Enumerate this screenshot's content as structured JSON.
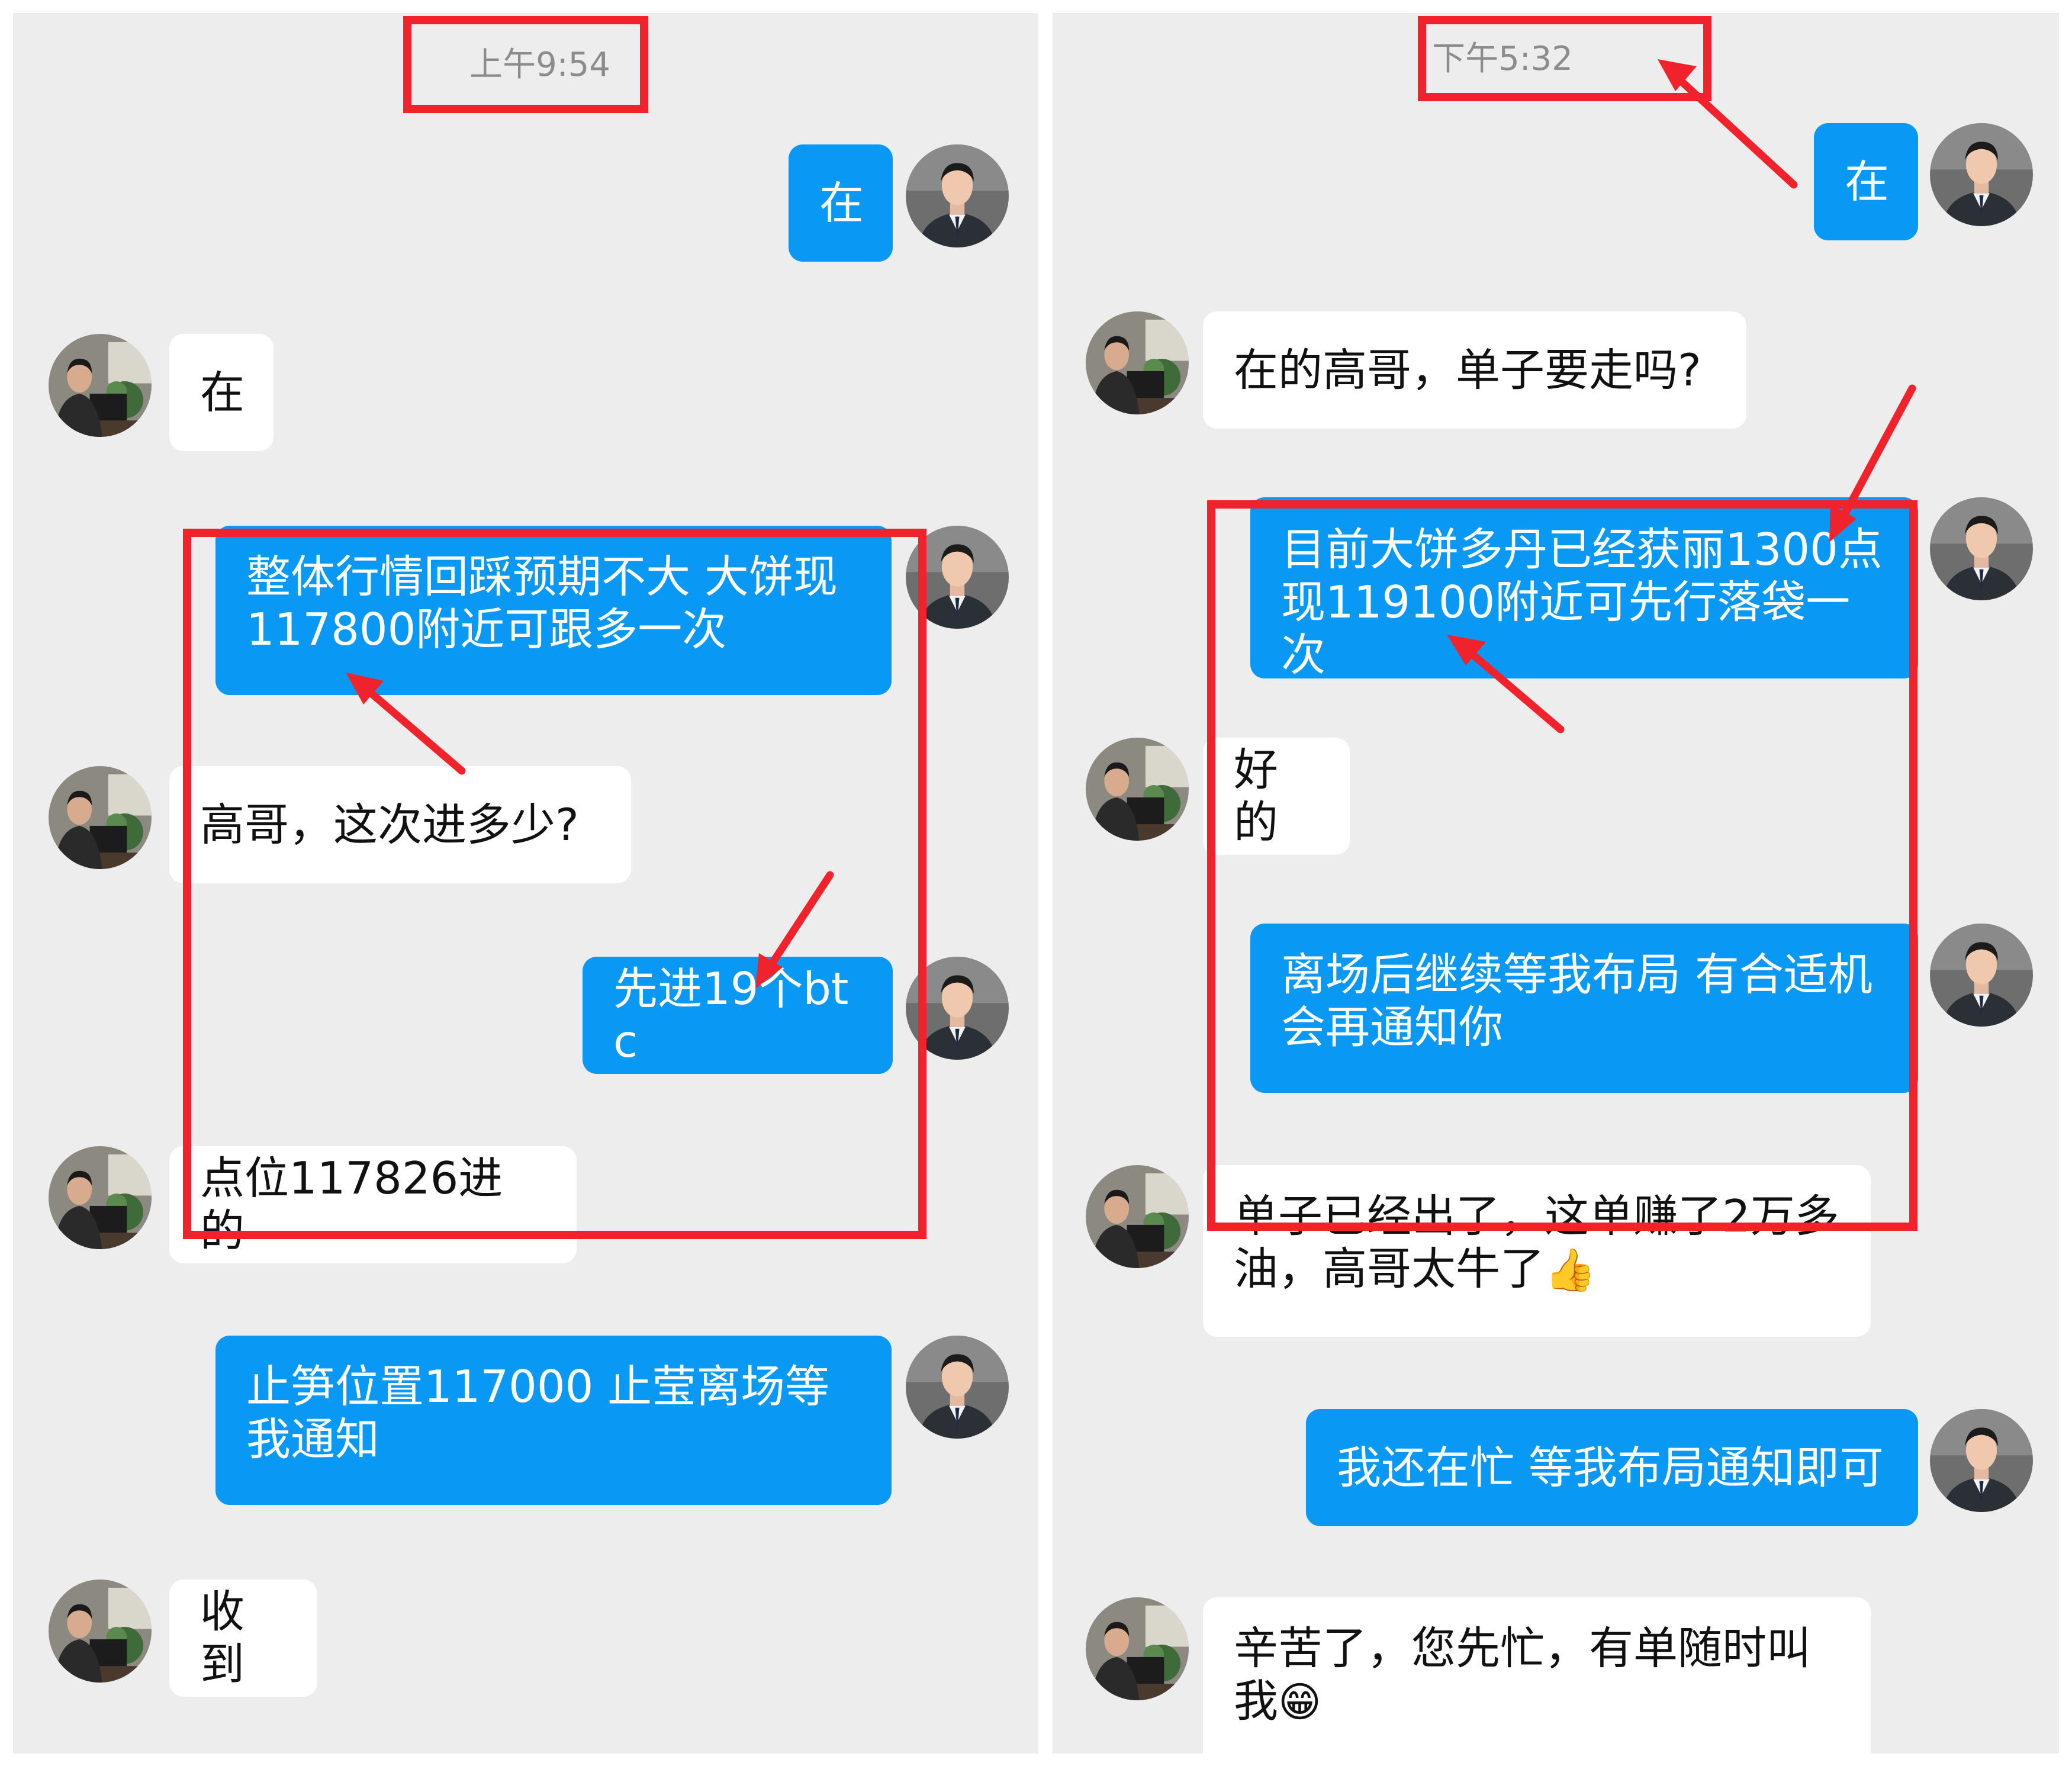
{
  "left_chat": {
    "timestamp": "上午9:54",
    "messages": [
      {
        "from": "me",
        "text": "在"
      },
      {
        "from": "other",
        "text": "在"
      },
      {
        "from": "me",
        "text": "整体行情回踩预期不大 大饼现117800附近可跟多一次"
      },
      {
        "from": "other",
        "text": "高哥，这次进多少?"
      },
      {
        "from": "me",
        "text": "先进19个btc"
      },
      {
        "from": "other",
        "text": "点位117826进的"
      },
      {
        "from": "me",
        "text": "止笋位置117000 止莹离场等我通知"
      },
      {
        "from": "other",
        "text": "收到"
      }
    ]
  },
  "right_chat": {
    "timestamp": "下午5:32",
    "messages": [
      {
        "from": "me",
        "text": "在"
      },
      {
        "from": "other",
        "text": "在的高哥，单子要走吗?"
      },
      {
        "from": "me",
        "text": "目前大饼多丹已经获丽1300点现119100附近可先行落袋一次"
      },
      {
        "from": "other",
        "text": "好的"
      },
      {
        "from": "me",
        "text": "离场后继续等我布局 有合适机会再通知你"
      },
      {
        "from": "other",
        "text": "单子已经出了，这单赚了2万多油，高哥太牛了",
        "emoji": "👍"
      },
      {
        "from": "me",
        "text": "我还在忙 等我布局通知即可"
      },
      {
        "from": "other",
        "text": "辛苦了，您先忙，有单随时叫我",
        "emoji": "😁"
      }
    ]
  },
  "colors": {
    "panel_bg": "#ededed",
    "outgoing_bubble": "#0a98f5",
    "incoming_bubble": "#ffffff",
    "highlight_red": "#f0222b",
    "timestamp_text": "#8c8c8c"
  },
  "icons": {
    "me_avatar": "man-in-suit-avatar",
    "other_avatar": "man-at-desk-avatar"
  }
}
